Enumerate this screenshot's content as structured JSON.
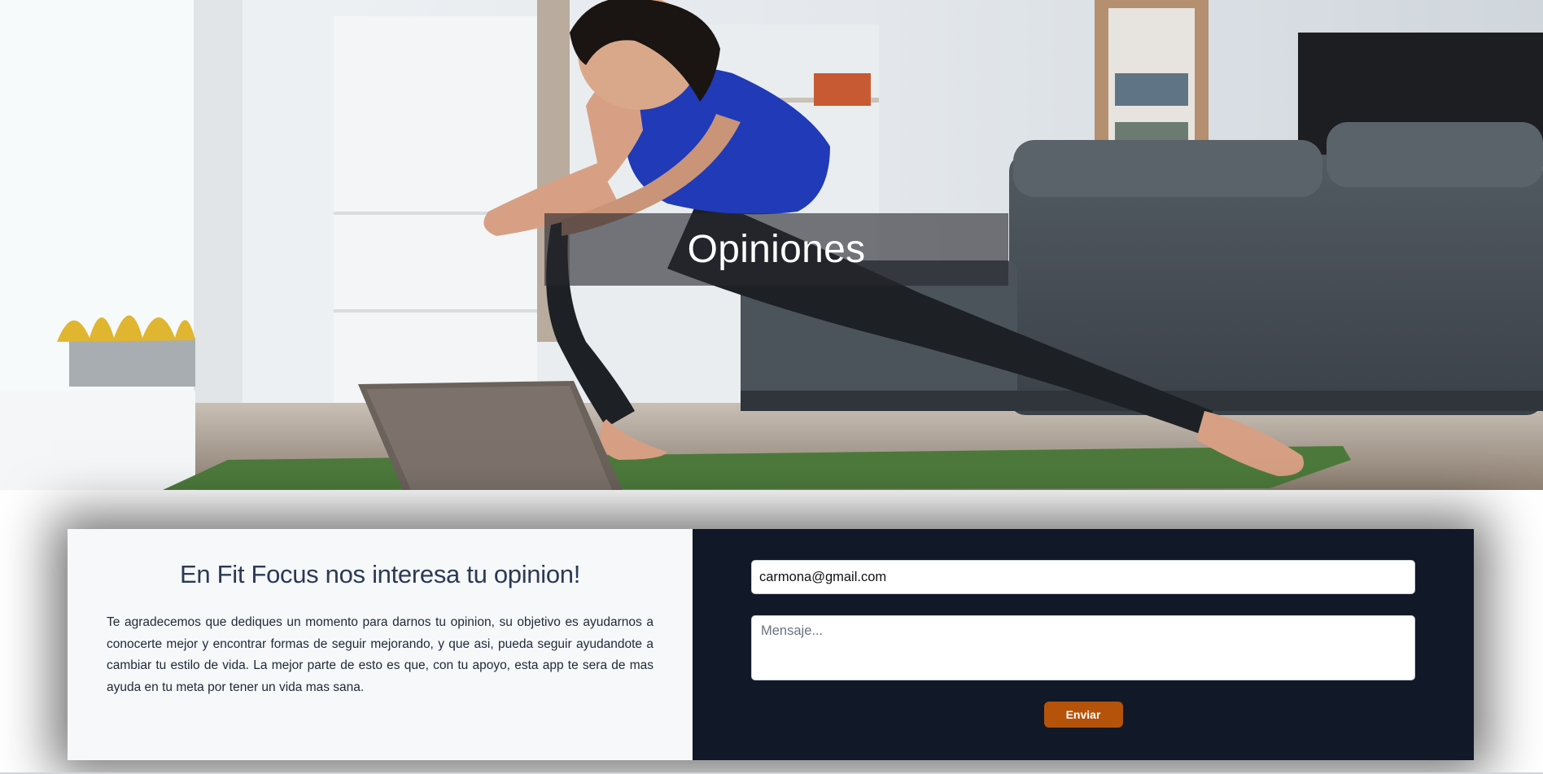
{
  "hero": {
    "title": "Opiniones",
    "image_description": "woman-stretching-on-yoga-mat-in-living-room"
  },
  "feedback": {
    "heading": "En Fit Focus nos interesa tu opinion!",
    "text": "Te agradecemos que dediques un momento para darnos tu opinion, su objetivo es ayudarnos a conocerte mejor y encontrar formas de seguir mejorando, y que asi, pueda seguir ayudandote a cambiar tu estilo de vida. La mejor parte de esto es que, con tu apoyo, esta app te sera de mas ayuda en tu meta por tener un vida mas sana."
  },
  "form": {
    "email_value": "carmona@gmail.com",
    "message_placeholder": "Mensaje...",
    "message_value": "",
    "submit_label": "Enviar"
  },
  "colors": {
    "left_panel_bg": "#f6f8fa",
    "right_panel_bg": "#111827",
    "heading_color": "#2b3a55",
    "button_bg": "#b45309"
  }
}
